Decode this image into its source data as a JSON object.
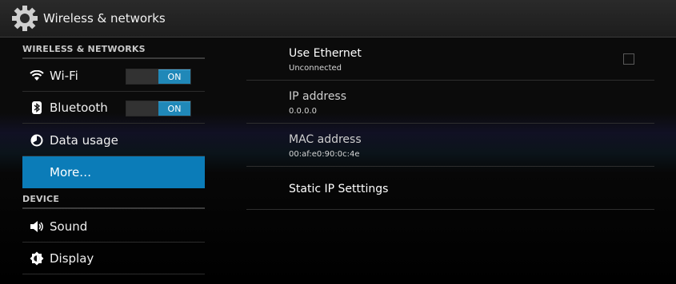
{
  "actionbar": {
    "title": "Wireless & networks",
    "icon": "settings-gear-icon"
  },
  "sections": {
    "wireless": "WIRELESS & NETWORKS",
    "device": "DEVICE"
  },
  "nav": {
    "wifi": {
      "label": "Wi-Fi",
      "icon": "wifi-icon",
      "toggle": "ON"
    },
    "bluetooth": {
      "label": "Bluetooth",
      "icon": "bluetooth-icon",
      "toggle": "ON"
    },
    "data_usage": {
      "label": "Data usage",
      "icon": "data-usage-icon"
    },
    "more": {
      "label": "More…"
    },
    "sound": {
      "label": "Sound",
      "icon": "speaker-icon"
    },
    "display": {
      "label": "Display",
      "icon": "brightness-icon"
    }
  },
  "prefs": {
    "ethernet": {
      "title": "Use Ethernet",
      "summary": "Unconnected",
      "checked": false
    },
    "ip": {
      "title": "IP address",
      "summary": "0.0.0.0"
    },
    "mac": {
      "title": "MAC address",
      "summary": "00:af:e0:90:0c:4e"
    },
    "static_ip": {
      "title": "Static IP Setttings"
    }
  },
  "colors": {
    "accent": "#0b7cb8",
    "toggle_on": "#2088b8"
  }
}
